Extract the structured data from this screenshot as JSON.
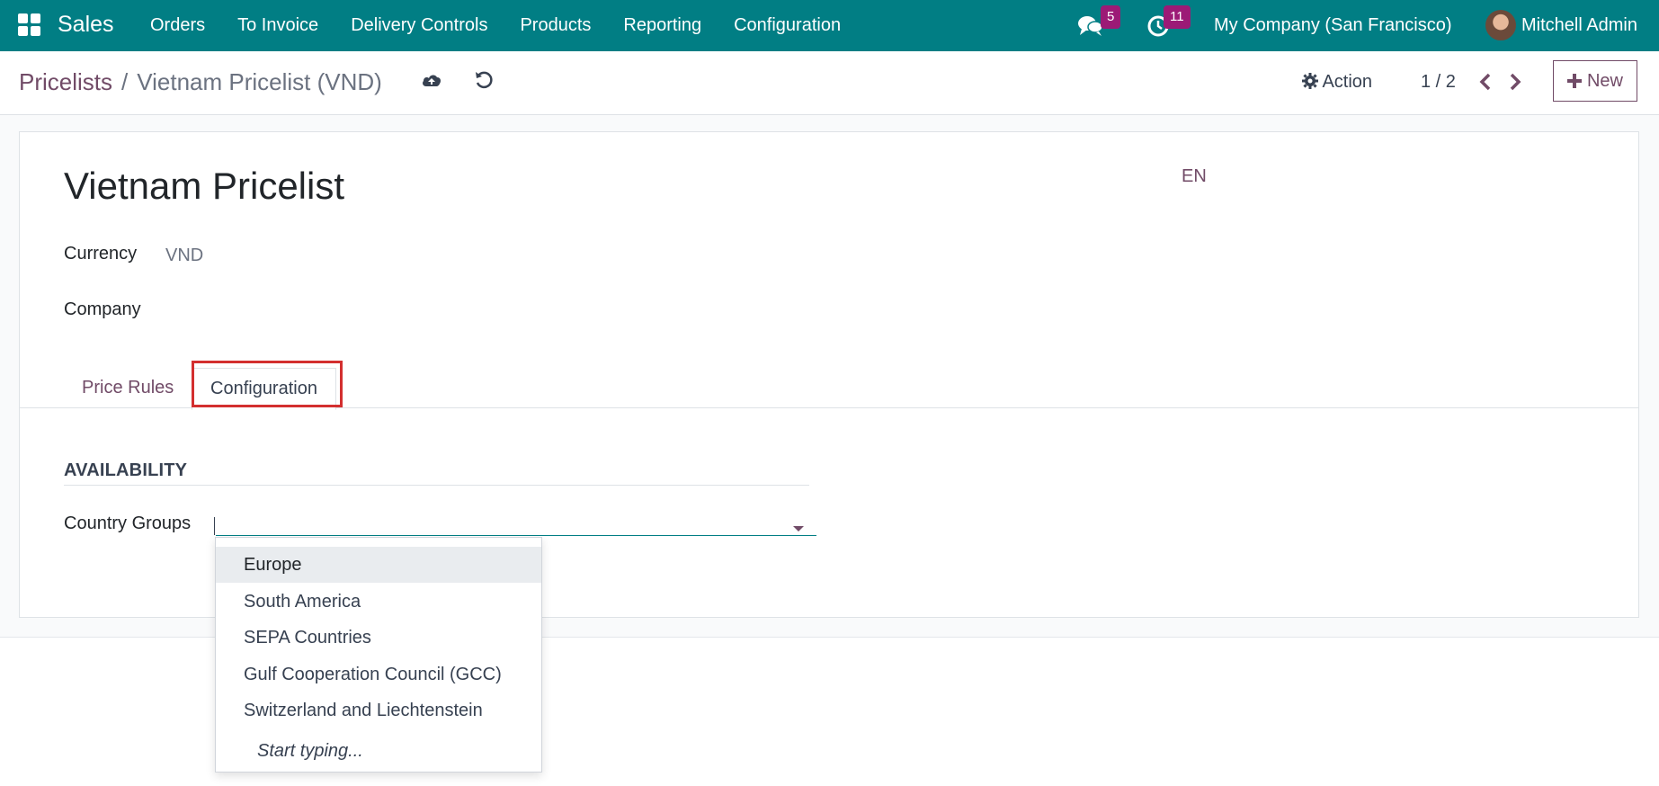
{
  "colors": {
    "brand": "#017e84",
    "accent": "#714b67",
    "badge": "#9c1a76",
    "highlight": "#d32f2f"
  },
  "navbar": {
    "apps_icon": "apps-grid-icon",
    "app_name": "Sales",
    "menu": [
      "Orders",
      "To Invoice",
      "Delivery Controls",
      "Products",
      "Reporting",
      "Configuration"
    ],
    "messages_icon": "chat-bubbles-icon",
    "messages_count": "5",
    "activities_icon": "clock-icon",
    "activities_count": "11",
    "company": "My Company (San Francisco)",
    "user_name": "Mitchell Admin"
  },
  "control_panel": {
    "breadcrumb_parent": "Pricelists",
    "breadcrumb_separator": "/",
    "breadcrumb_current": "Vietnam Pricelist (VND)",
    "save_icon": "cloud-upload-icon",
    "discard_icon": "undo-icon",
    "action_label": "Action",
    "action_icon": "gear-icon",
    "pager": "1 / 2",
    "new_label": "New"
  },
  "form": {
    "title": "Vietnam Pricelist",
    "language": "EN",
    "currency_label": "Currency",
    "currency_value": "VND",
    "company_label": "Company",
    "company_value": "",
    "tabs": [
      "Price Rules",
      "Configuration"
    ],
    "active_tab": "Configuration",
    "section_title": "AVAILABILITY",
    "country_groups_label": "Country Groups",
    "country_groups_value": ""
  },
  "dropdown": {
    "items": [
      "Europe",
      "South America",
      "SEPA Countries",
      "Gulf Cooperation Council (GCC)",
      "Switzerland and Liechtenstein"
    ],
    "hint": "Start typing..."
  }
}
